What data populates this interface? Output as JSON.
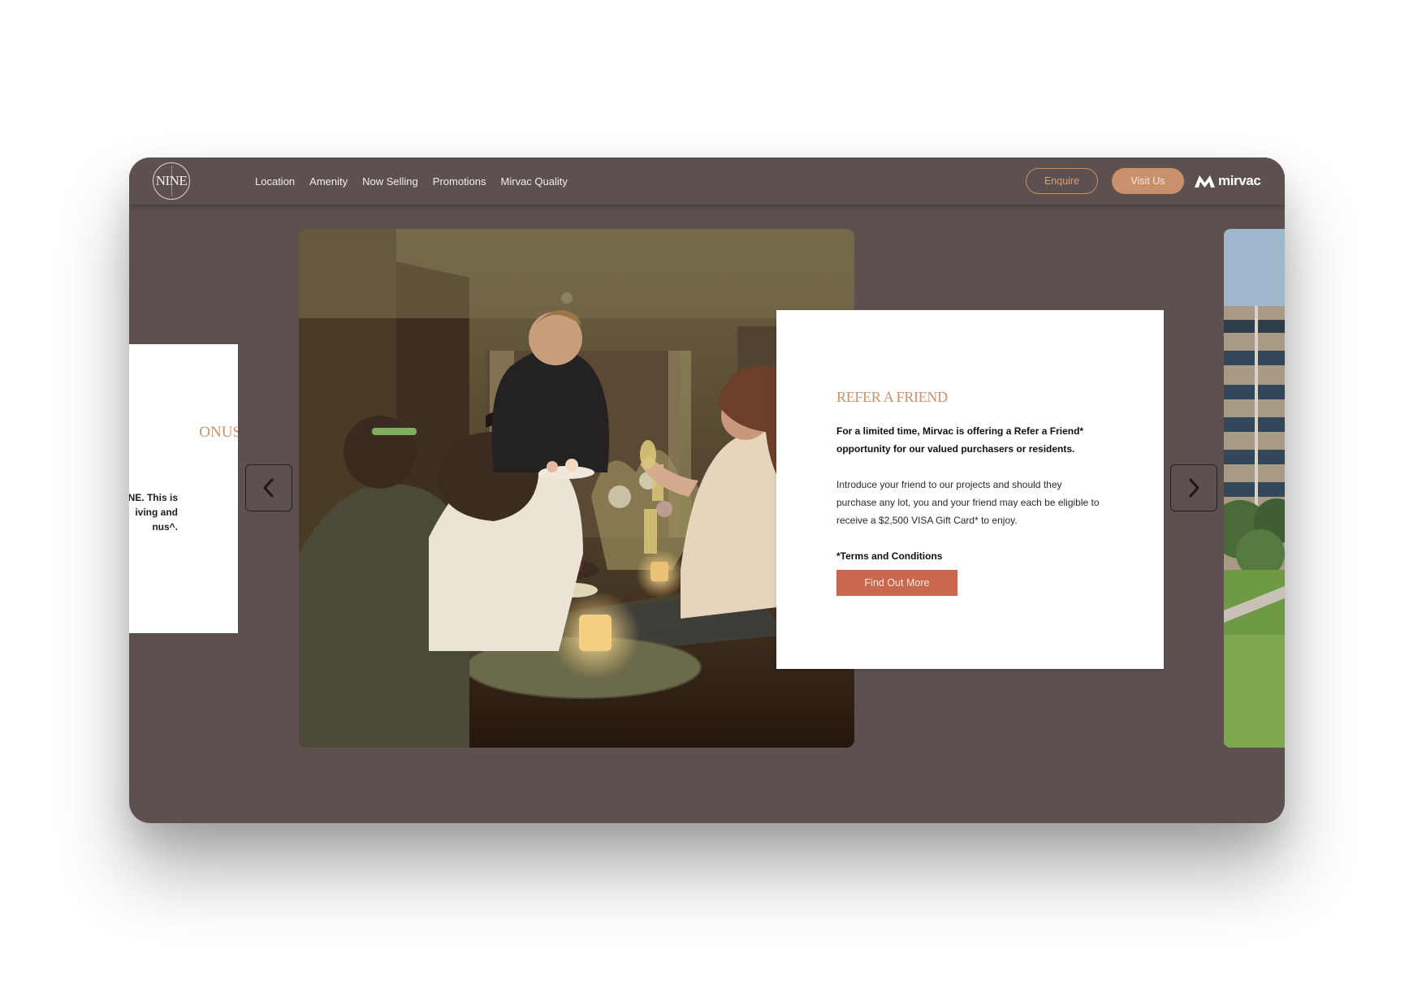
{
  "brand": {
    "logo_text": "NINE",
    "company": "mirvac",
    "accent": "#c8916b",
    "cta_color": "#c9684c",
    "frame_color": "#5c514f"
  },
  "nav": {
    "items": [
      {
        "label": "Location"
      },
      {
        "label": "Amenity"
      },
      {
        "label": "Now Selling"
      },
      {
        "label": "Promotions"
      },
      {
        "label": "Mirvac Quality"
      }
    ],
    "enquire_label": "Enquire",
    "visit_label": "Visit Us"
  },
  "carousel": {
    "prev_slide": {
      "title_fragment": "ONUS",
      "lines": [
        "NE. This is",
        "iving and",
        "nus^."
      ]
    },
    "current_slide": {
      "title": "REFER A FRIEND",
      "lead": "For a limited time, Mirvac is offering a Refer a Friend* opportunity for our valued purchasers or residents.",
      "body": "Introduce your friend to our projects and should they purchase any lot, you and your friend may each be eligible to receive a $2,500 VISA Gift Card* to enjoy.",
      "terms": "*Terms and Conditions",
      "cta_label": "Find Out More"
    },
    "prev_icon": "chevron-left-icon",
    "next_icon": "chevron-right-icon"
  }
}
